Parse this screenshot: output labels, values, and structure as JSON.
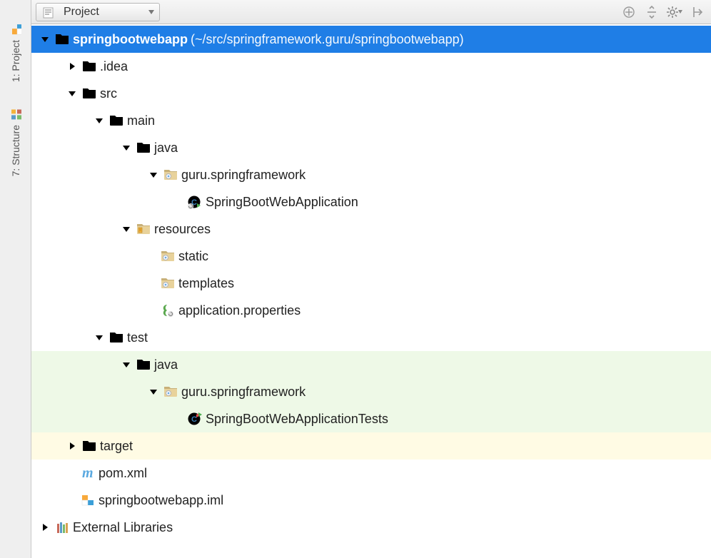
{
  "sidebar": {
    "project_tab": "1: Project",
    "structure_tab": "7: Structure"
  },
  "toolbar": {
    "view_label": "Project"
  },
  "tree": {
    "root_name": "springbootwebapp",
    "root_path": "(~/src/springframework.guru/springbootwebapp)",
    "idea": ".idea",
    "src": "src",
    "main": "main",
    "java": "java",
    "pkg": "guru.springframework",
    "app_class": "SpringBootWebApplication",
    "resources": "resources",
    "static": "static",
    "templates": "templates",
    "app_props": "application.properties",
    "test": "test",
    "test_java": "java",
    "test_pkg": "guru.springframework",
    "test_class": "SpringBootWebApplicationTests",
    "target": "target",
    "pom": "pom.xml",
    "iml": "springbootwebapp.iml",
    "external": "External Libraries"
  }
}
